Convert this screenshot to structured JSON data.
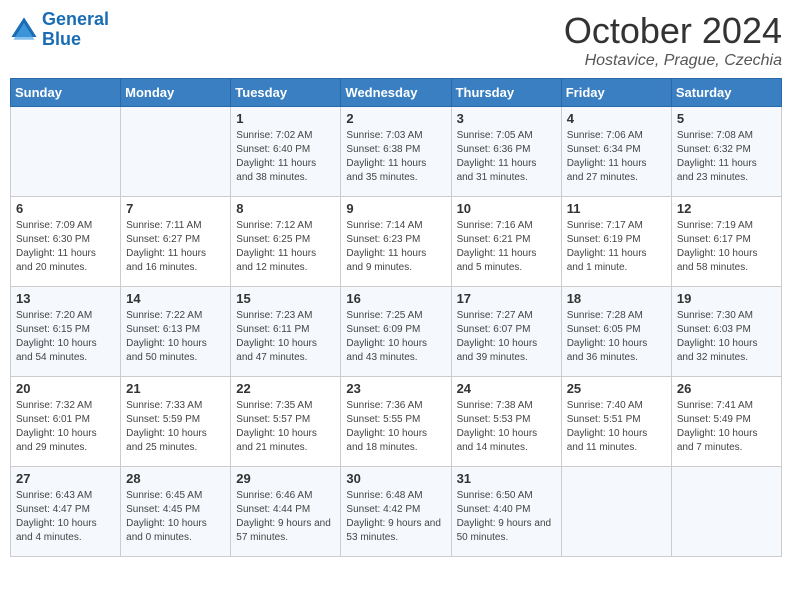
{
  "logo": {
    "line1": "General",
    "line2": "Blue"
  },
  "title": "October 2024",
  "location": "Hostavice, Prague, Czechia",
  "days_of_week": [
    "Sunday",
    "Monday",
    "Tuesday",
    "Wednesday",
    "Thursday",
    "Friday",
    "Saturday"
  ],
  "weeks": [
    [
      {
        "day": "",
        "info": ""
      },
      {
        "day": "",
        "info": ""
      },
      {
        "day": "1",
        "info": "Sunrise: 7:02 AM\nSunset: 6:40 PM\nDaylight: 11 hours and 38 minutes."
      },
      {
        "day": "2",
        "info": "Sunrise: 7:03 AM\nSunset: 6:38 PM\nDaylight: 11 hours and 35 minutes."
      },
      {
        "day": "3",
        "info": "Sunrise: 7:05 AM\nSunset: 6:36 PM\nDaylight: 11 hours and 31 minutes."
      },
      {
        "day": "4",
        "info": "Sunrise: 7:06 AM\nSunset: 6:34 PM\nDaylight: 11 hours and 27 minutes."
      },
      {
        "day": "5",
        "info": "Sunrise: 7:08 AM\nSunset: 6:32 PM\nDaylight: 11 hours and 23 minutes."
      }
    ],
    [
      {
        "day": "6",
        "info": "Sunrise: 7:09 AM\nSunset: 6:30 PM\nDaylight: 11 hours and 20 minutes."
      },
      {
        "day": "7",
        "info": "Sunrise: 7:11 AM\nSunset: 6:27 PM\nDaylight: 11 hours and 16 minutes."
      },
      {
        "day": "8",
        "info": "Sunrise: 7:12 AM\nSunset: 6:25 PM\nDaylight: 11 hours and 12 minutes."
      },
      {
        "day": "9",
        "info": "Sunrise: 7:14 AM\nSunset: 6:23 PM\nDaylight: 11 hours and 9 minutes."
      },
      {
        "day": "10",
        "info": "Sunrise: 7:16 AM\nSunset: 6:21 PM\nDaylight: 11 hours and 5 minutes."
      },
      {
        "day": "11",
        "info": "Sunrise: 7:17 AM\nSunset: 6:19 PM\nDaylight: 11 hours and 1 minute."
      },
      {
        "day": "12",
        "info": "Sunrise: 7:19 AM\nSunset: 6:17 PM\nDaylight: 10 hours and 58 minutes."
      }
    ],
    [
      {
        "day": "13",
        "info": "Sunrise: 7:20 AM\nSunset: 6:15 PM\nDaylight: 10 hours and 54 minutes."
      },
      {
        "day": "14",
        "info": "Sunrise: 7:22 AM\nSunset: 6:13 PM\nDaylight: 10 hours and 50 minutes."
      },
      {
        "day": "15",
        "info": "Sunrise: 7:23 AM\nSunset: 6:11 PM\nDaylight: 10 hours and 47 minutes."
      },
      {
        "day": "16",
        "info": "Sunrise: 7:25 AM\nSunset: 6:09 PM\nDaylight: 10 hours and 43 minutes."
      },
      {
        "day": "17",
        "info": "Sunrise: 7:27 AM\nSunset: 6:07 PM\nDaylight: 10 hours and 39 minutes."
      },
      {
        "day": "18",
        "info": "Sunrise: 7:28 AM\nSunset: 6:05 PM\nDaylight: 10 hours and 36 minutes."
      },
      {
        "day": "19",
        "info": "Sunrise: 7:30 AM\nSunset: 6:03 PM\nDaylight: 10 hours and 32 minutes."
      }
    ],
    [
      {
        "day": "20",
        "info": "Sunrise: 7:32 AM\nSunset: 6:01 PM\nDaylight: 10 hours and 29 minutes."
      },
      {
        "day": "21",
        "info": "Sunrise: 7:33 AM\nSunset: 5:59 PM\nDaylight: 10 hours and 25 minutes."
      },
      {
        "day": "22",
        "info": "Sunrise: 7:35 AM\nSunset: 5:57 PM\nDaylight: 10 hours and 21 minutes."
      },
      {
        "day": "23",
        "info": "Sunrise: 7:36 AM\nSunset: 5:55 PM\nDaylight: 10 hours and 18 minutes."
      },
      {
        "day": "24",
        "info": "Sunrise: 7:38 AM\nSunset: 5:53 PM\nDaylight: 10 hours and 14 minutes."
      },
      {
        "day": "25",
        "info": "Sunrise: 7:40 AM\nSunset: 5:51 PM\nDaylight: 10 hours and 11 minutes."
      },
      {
        "day": "26",
        "info": "Sunrise: 7:41 AM\nSunset: 5:49 PM\nDaylight: 10 hours and 7 minutes."
      }
    ],
    [
      {
        "day": "27",
        "info": "Sunrise: 6:43 AM\nSunset: 4:47 PM\nDaylight: 10 hours and 4 minutes."
      },
      {
        "day": "28",
        "info": "Sunrise: 6:45 AM\nSunset: 4:45 PM\nDaylight: 10 hours and 0 minutes."
      },
      {
        "day": "29",
        "info": "Sunrise: 6:46 AM\nSunset: 4:44 PM\nDaylight: 9 hours and 57 minutes."
      },
      {
        "day": "30",
        "info": "Sunrise: 6:48 AM\nSunset: 4:42 PM\nDaylight: 9 hours and 53 minutes."
      },
      {
        "day": "31",
        "info": "Sunrise: 6:50 AM\nSunset: 4:40 PM\nDaylight: 9 hours and 50 minutes."
      },
      {
        "day": "",
        "info": ""
      },
      {
        "day": "",
        "info": ""
      }
    ]
  ]
}
